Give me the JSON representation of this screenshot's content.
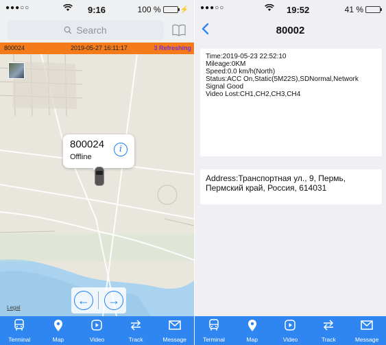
{
  "left": {
    "status": {
      "time": "9:16",
      "battery": "100 %",
      "battery_fill": 1.0,
      "battery_color": "#3ccb3c"
    },
    "search": {
      "placeholder": "Search"
    },
    "infobar": {
      "device": "800024",
      "datetime": "2019-05-27 16:11:17",
      "refresh": "3 Refreshing"
    },
    "callout": {
      "device_id": "800024",
      "state": "Offline"
    },
    "map": {
      "legal": "Legal"
    }
  },
  "right": {
    "status": {
      "time": "19:52",
      "battery": "41 %",
      "battery_fill": 0.41,
      "battery_color": "#111111"
    },
    "title": "80002",
    "details": [
      "Time:2019-05-23 22:52:10",
      "Mileage:0KM",
      "Speed:0.0 km/h(North)",
      "Status:ACC On,Static(5M22S),SDNormal,Network",
      "Signal Good",
      "Video Lost:CH1,CH2,CH3,CH4"
    ],
    "address": [
      "Address:Транспортная ул., 9, Пермь,",
      "Пермский край, Россия, 614031"
    ]
  },
  "tabs": [
    {
      "label": "Terminal",
      "icon": "bus-icon"
    },
    {
      "label": "Map",
      "icon": "location-pin-icon"
    },
    {
      "label": "Video",
      "icon": "video-play-icon"
    },
    {
      "label": "Track",
      "icon": "track-arrows-icon"
    },
    {
      "label": "Message",
      "icon": "envelope-icon"
    }
  ],
  "colors": {
    "accent": "#2f86f0",
    "infobar": "#f47a1a",
    "refresh": "#7a2fd0",
    "link_blue": "#1a7cf4"
  }
}
